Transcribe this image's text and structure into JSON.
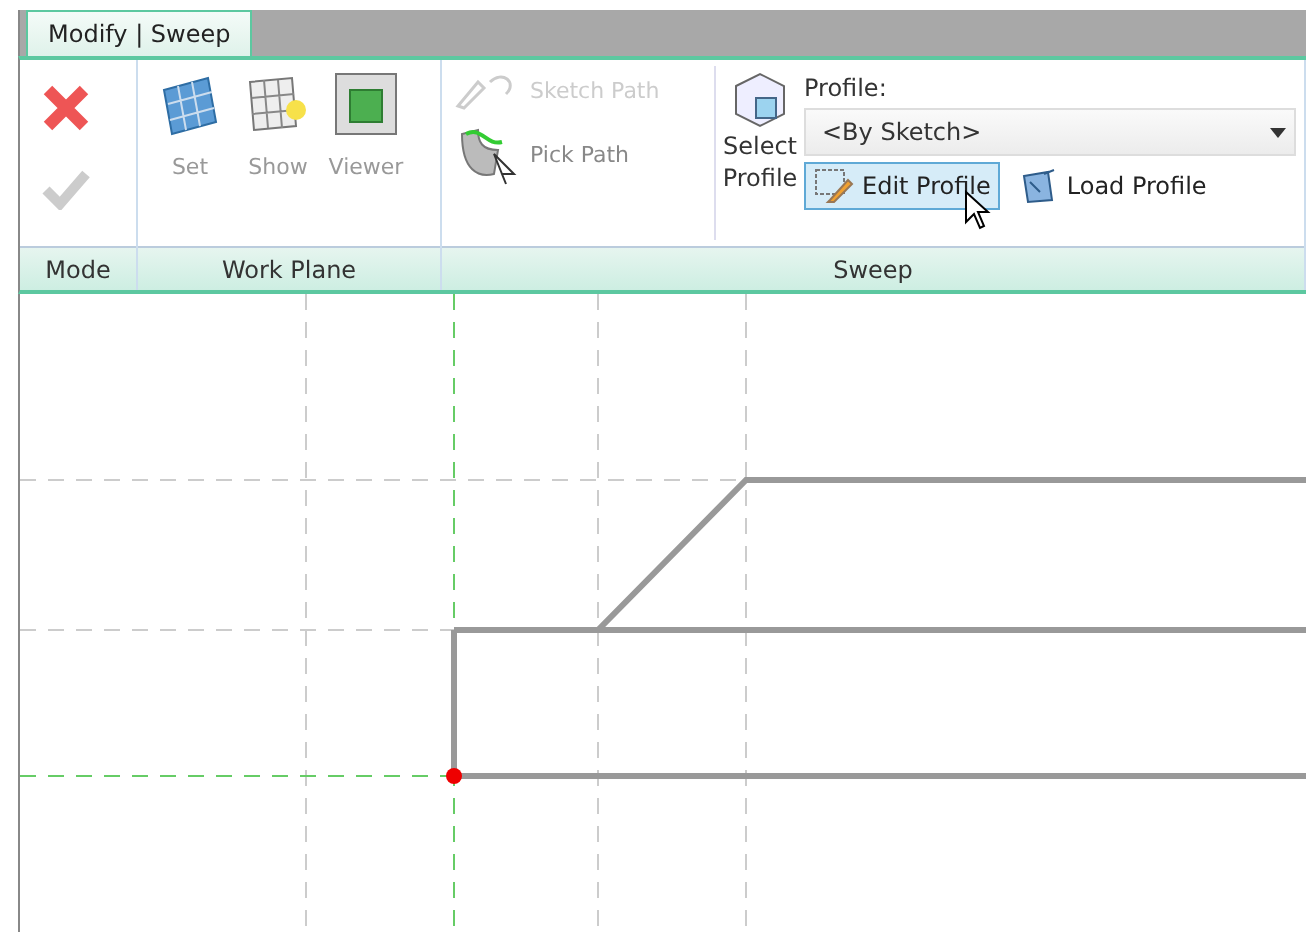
{
  "tab": {
    "label": "Modify | Sweep",
    "selected": true
  },
  "mode": {
    "label": "Mode",
    "buttons": [
      {
        "kind": "cancel",
        "disabled": false
      },
      {
        "kind": "finish",
        "disabled": true
      }
    ]
  },
  "work_plane": {
    "label": "Work Plane",
    "buttons": [
      {
        "kind": "set",
        "label": "Set"
      },
      {
        "kind": "show",
        "label": "Show"
      },
      {
        "kind": "viewer",
        "label": "Viewer"
      }
    ]
  },
  "sweep": {
    "label": "Sweep",
    "path_buttons": [
      {
        "kind": "sketch",
        "label": "Sketch Path",
        "disabled": true
      },
      {
        "kind": "pick",
        "label": "Pick Path",
        "disabled": false
      }
    ],
    "select_profile": {
      "label": "Select Profile"
    },
    "profile": {
      "label": "Profile:",
      "value": "<By Sketch>"
    },
    "profile_buttons": [
      {
        "kind": "edit",
        "label": "Edit Profile",
        "selected": true
      },
      {
        "kind": "load",
        "label": "Load Profile",
        "selected": false
      }
    ]
  }
}
